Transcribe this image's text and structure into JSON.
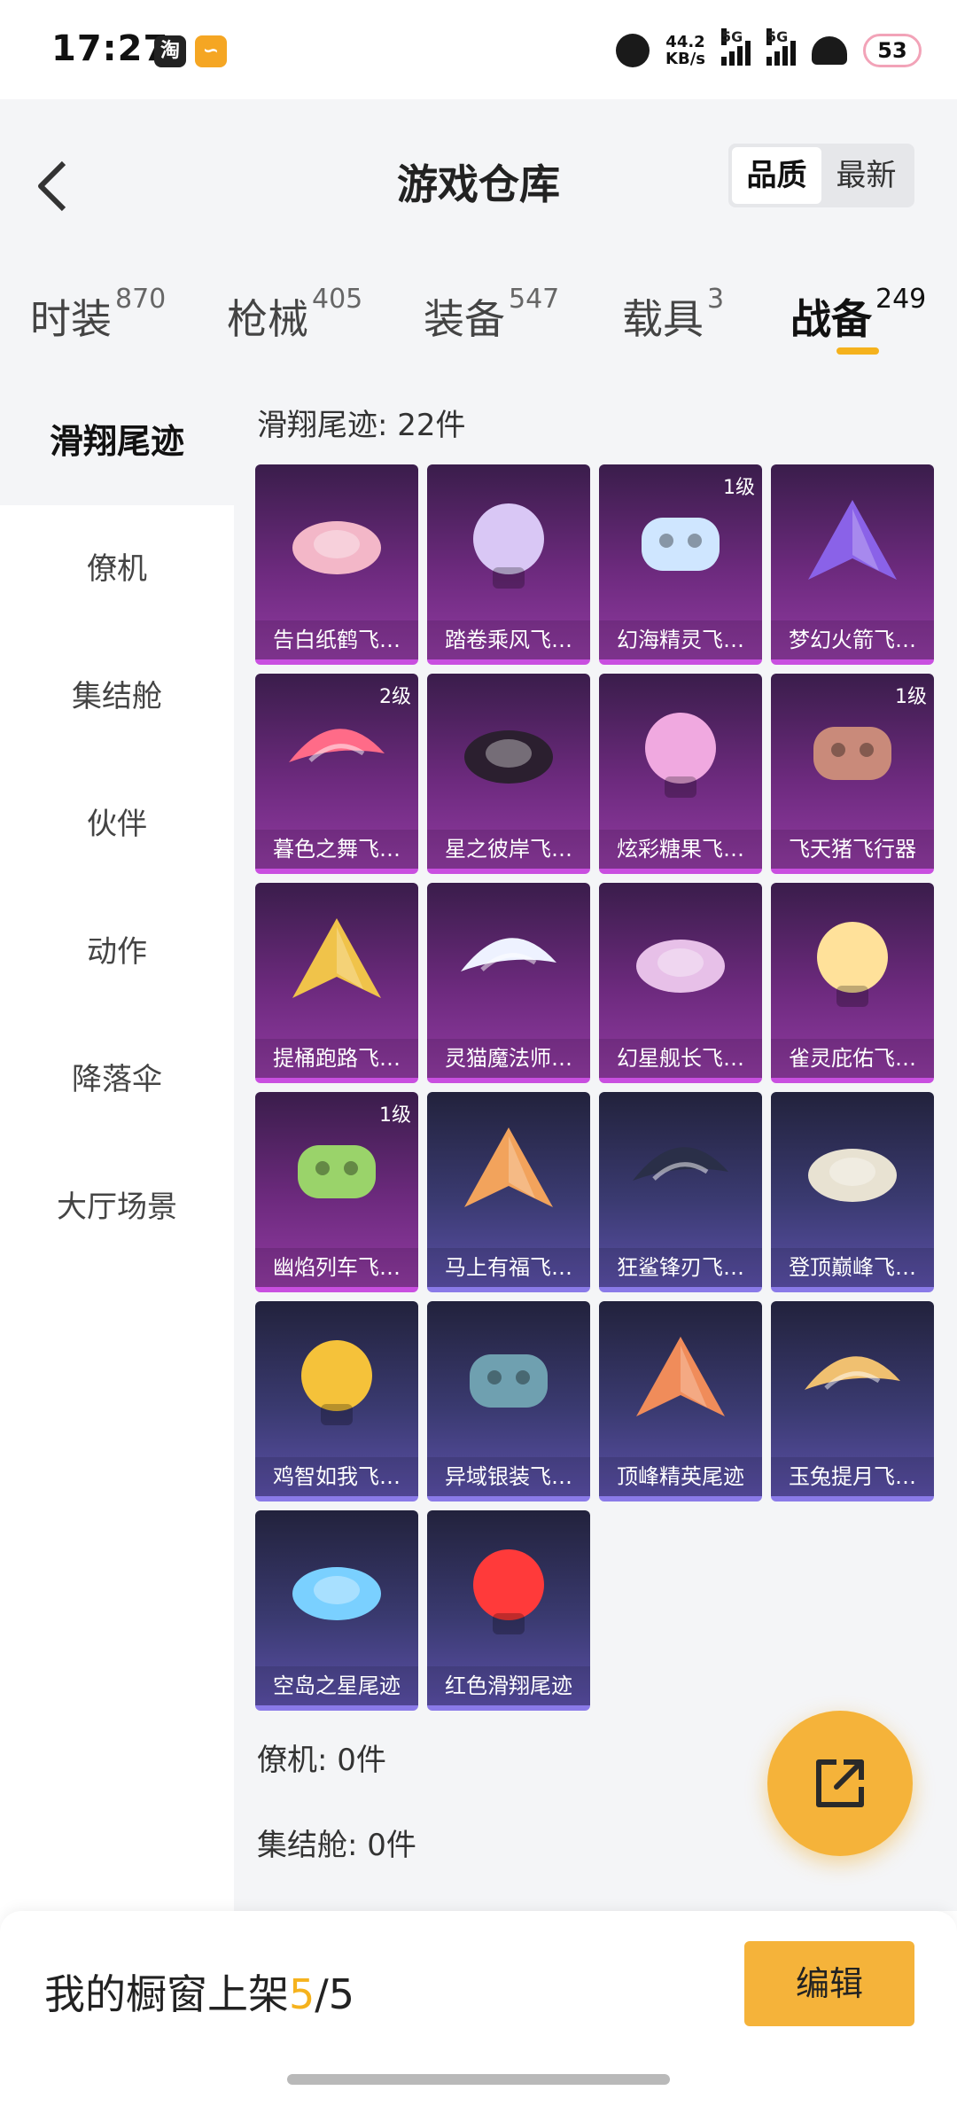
{
  "status": {
    "time": "17:27",
    "speed_top": "44.2",
    "speed_bottom": "KB/s",
    "net1": "5G",
    "net2": "5G",
    "battery": "53"
  },
  "header": {
    "title": "游戏仓库",
    "sort_quality": "品质",
    "sort_latest": "最新"
  },
  "tabs": [
    {
      "label": "时装",
      "count": "870"
    },
    {
      "label": "枪械",
      "count": "405"
    },
    {
      "label": "装备",
      "count": "547"
    },
    {
      "label": "载具",
      "count": "3"
    },
    {
      "label": "战备",
      "count": "249"
    }
  ],
  "sidebar": [
    "滑翔尾迹",
    "僚机",
    "集结舱",
    "伙伴",
    "动作",
    "降落伞",
    "大厅场景"
  ],
  "sections": {
    "glide": "滑翔尾迹: 22件",
    "wingman": "僚机: 0件",
    "pod": "集结舱: 0件"
  },
  "items": [
    {
      "name": "告白纸鹤飞…",
      "level": "",
      "theme": "purple",
      "color": "#f3b7c8"
    },
    {
      "name": "踏卷乘风飞…",
      "level": "",
      "theme": "purple",
      "color": "#d9c7f5"
    },
    {
      "name": "幻海精灵飞…",
      "level": "1级",
      "theme": "purple",
      "color": "#cfe6ff"
    },
    {
      "name": "梦幻火箭飞…",
      "level": "",
      "theme": "purple",
      "color": "#8a62e8"
    },
    {
      "name": "暮色之舞飞…",
      "level": "2级",
      "theme": "purple",
      "color": "#ff6b88"
    },
    {
      "name": "星之彼岸飞…",
      "level": "",
      "theme": "purple",
      "color": "#2b1f2f"
    },
    {
      "name": "炫彩糖果飞…",
      "level": "",
      "theme": "purple",
      "color": "#f0a9e0"
    },
    {
      "name": "飞天猪飞行器",
      "level": "1级",
      "theme": "purple",
      "color": "#c98a7a"
    },
    {
      "name": "提桶跑路飞…",
      "level": "",
      "theme": "purple",
      "color": "#f0c34a"
    },
    {
      "name": "灵猫魔法师…",
      "level": "",
      "theme": "purple",
      "color": "#eef2ff"
    },
    {
      "name": "幻星舰长飞…",
      "level": "",
      "theme": "purple",
      "color": "#e7c0e8"
    },
    {
      "name": "雀灵庇佑飞…",
      "level": "",
      "theme": "purple",
      "color": "#ffe19a"
    },
    {
      "name": "幽焰列车飞…",
      "level": "1级",
      "theme": "purple",
      "color": "#9ad36a"
    },
    {
      "name": "马上有福飞…",
      "level": "",
      "theme": "blue",
      "color": "#f2a35c"
    },
    {
      "name": "狂鲨锋刃飞…",
      "level": "",
      "theme": "blue",
      "color": "#2a2f48"
    },
    {
      "name": "登顶巅峰飞…",
      "level": "",
      "theme": "blue",
      "color": "#e8e2d2"
    },
    {
      "name": "鸡智如我飞…",
      "level": "",
      "theme": "blue",
      "color": "#f5c23a"
    },
    {
      "name": "异域银装飞…",
      "level": "",
      "theme": "blue",
      "color": "#6fa0b0"
    },
    {
      "name": "顶峰精英尾迹",
      "level": "",
      "theme": "blue",
      "color": "#f08c5a"
    },
    {
      "name": "玉兔提月飞…",
      "level": "",
      "theme": "blue",
      "color": "#f0c070"
    },
    {
      "name": "空岛之星尾迹",
      "level": "",
      "theme": "blue",
      "color": "#7ad0ff"
    },
    {
      "name": "红色滑翔尾迹",
      "level": "",
      "theme": "blue",
      "color": "#ff3a3a"
    }
  ],
  "bottom": {
    "prefix": "我的橱窗上架",
    "current": "5",
    "total": "/5",
    "edit": "编辑"
  },
  "icons": {
    "back": "chevron-left-icon",
    "share": "share-external-icon"
  }
}
